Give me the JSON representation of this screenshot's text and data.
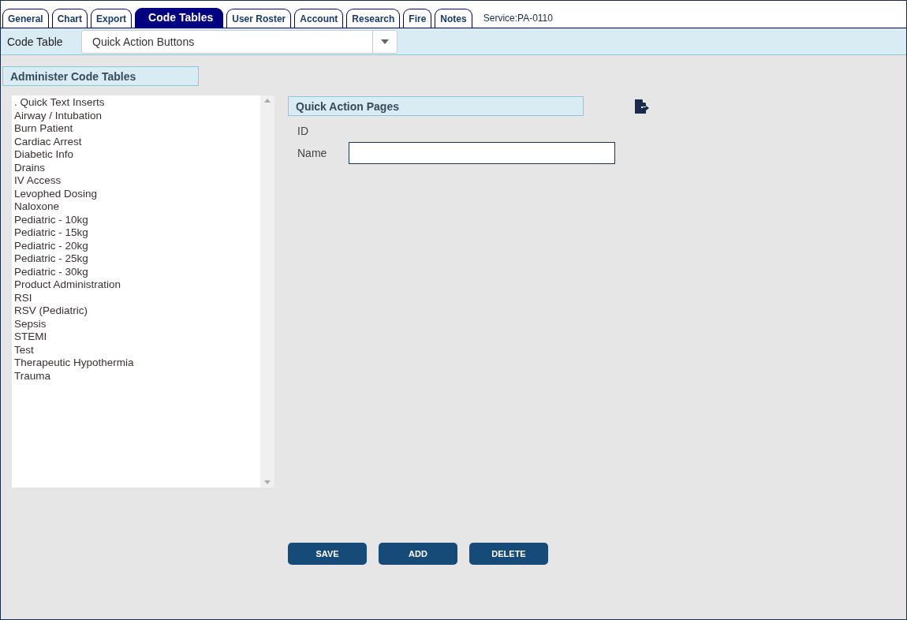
{
  "tabs": [
    {
      "label": "General",
      "selected": false
    },
    {
      "label": "Chart",
      "selected": false
    },
    {
      "label": "Export",
      "selected": false
    },
    {
      "label": "Code Tables",
      "selected": true
    },
    {
      "label": "User Roster",
      "selected": false
    },
    {
      "label": "Account",
      "selected": false
    },
    {
      "label": "Research",
      "selected": false
    },
    {
      "label": "Fire",
      "selected": false
    },
    {
      "label": "Notes",
      "selected": false
    }
  ],
  "service": "Service:PA-0110",
  "code_table": {
    "label": "Code Table",
    "value": "Quick Action Buttons"
  },
  "left_panel": {
    "title": "Administer Code Tables",
    "items": [
      ". Quick Text Inserts",
      "Airway / Intubation",
      "Burn Patient",
      "Cardiac Arrest",
      "Diabetic Info",
      "Drains",
      "IV Access",
      "Levophed Dosing",
      "Naloxone",
      "Pediatric - 10kg",
      "Pediatric - 15kg",
      "Pediatric - 20kg",
      "Pediatric - 25kg",
      "Pediatric - 30kg",
      "Product Administration",
      "RSI",
      "RSV (Pediatric)",
      "Sepsis",
      "STEMI",
      "Test",
      "Therapeutic Hypothermia",
      "Trauma"
    ]
  },
  "form": {
    "title": "Quick Action Pages",
    "id_label": "ID",
    "name_label": "Name"
  },
  "buttons": [
    "SAVE",
    "ADD",
    "DELETE"
  ]
}
